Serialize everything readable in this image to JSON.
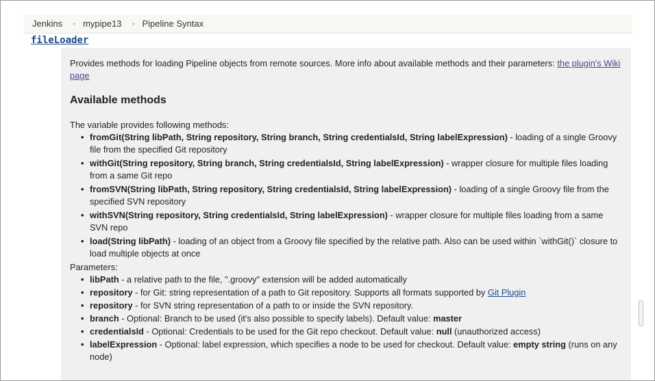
{
  "breadcrumb": {
    "items": [
      "Jenkins",
      "mypipe13",
      "Pipeline Syntax"
    ],
    "separator": "▸"
  },
  "step": {
    "name": "fileLoader"
  },
  "help": {
    "intro_text": "Provides methods for loading Pipeline objects from remote sources. More info about available methods and their parameters: ",
    "intro_link": "the plugin's Wiki page",
    "section_title": "Available methods",
    "methods_lead": "The variable provides following methods:",
    "methods": [
      {
        "sig": "fromGit(String libPath, String repository, String branch, String credentialsId, String labelExpression)",
        "desc": " - loading of a single Groovy file from the specified Git repository"
      },
      {
        "sig": "withGit(String repository, String branch, String credentialsId, String labelExpression)",
        "desc": " - wrapper closure for multiple files loading from a same Git repo"
      },
      {
        "sig": "fromSVN(String libPath, String repository, String credentialsId, String labelExpression)",
        "desc": " - loading of a single Groovy file from the specified SVN repository"
      },
      {
        "sig": "withSVN(String repository, String credentialsId, String labelExpression)",
        "desc": " - wrapper closure for multiple files loading from a same SVN repo"
      },
      {
        "sig": "load(String libPath)",
        "desc": " - loading of an object from a Groovy file specified by the relative path. Also can be used within `withGit()` closure to load multiple objects at once"
      }
    ],
    "params_lead": "Parameters:",
    "params": [
      {
        "name": "libPath",
        "desc": " - a relative path to the file, \".groovy\" extension will be added automatically"
      },
      {
        "name": "repository",
        "desc": " - for Git: string representation of a path to Git repository. Supports all formats supported by ",
        "link": "Git Plugin"
      },
      {
        "name": "repository",
        "desc": " - for SVN string representation of a path to or inside the SVN repository."
      },
      {
        "name": "branch",
        "desc": " - Optional: Branch to be used (it's also possible to specify labels). Default value: ",
        "bold_tail": "master"
      },
      {
        "name": "credentialsId",
        "desc": " - Optional: Credentials to be used for the Git repo checkout. Default value: ",
        "bold_tail": "null",
        "tail": " (unauthorized access)"
      },
      {
        "name": "labelExpression",
        "desc": " - Optional: label expression, which specifies a node to be used for checkout. Default value: ",
        "bold_tail": "empty string",
        "tail": " (runs on any node)"
      }
    ]
  },
  "colors": {
    "link_visited": "#5d3a8f",
    "link": "#1c4a8a",
    "panel_bg": "#f0f0f0"
  }
}
